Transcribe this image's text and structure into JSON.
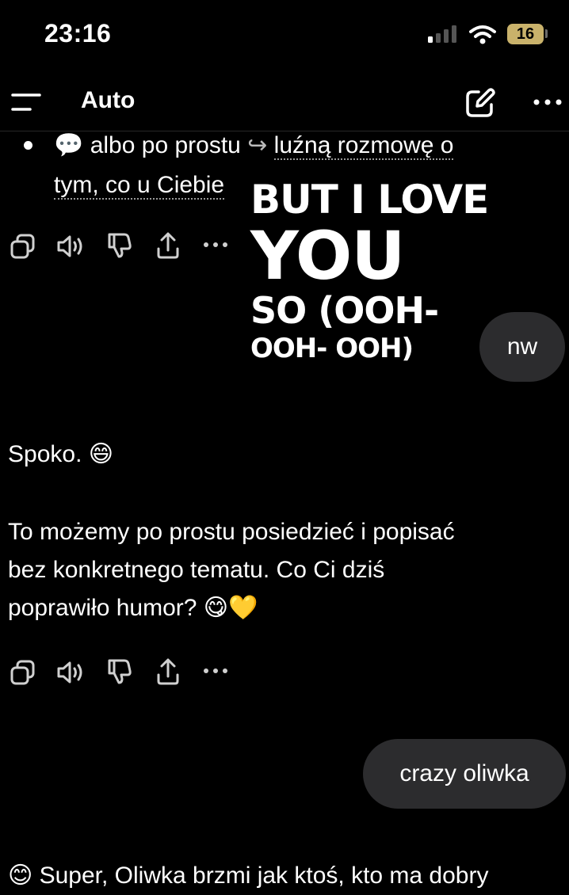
{
  "status_bar": {
    "time": "23:16",
    "battery_level": "16"
  },
  "header": {
    "title": "Auto",
    "menu_icon": "hamburger-menu-icon",
    "compose_icon": "compose-icon",
    "more_icon": "ellipsis-icon"
  },
  "chat": {
    "bullet_item": {
      "emoji": "💬",
      "text_before": "albo po prostu",
      "arrow": "↪",
      "link_part1": "luźną rozmowę o",
      "link_part2": "tym, co u Ciebie"
    },
    "lyrics_overlay": {
      "line1": "BUT I LOVE",
      "line2": "YOU",
      "line3": "SO (OOH-",
      "line4": "OOH- OOH)"
    },
    "user_message_1": "nw",
    "assistant_reply": {
      "line1": "Spoko. 😄",
      "paragraph_line1": "To możemy po prostu posiedzieć i popisać",
      "paragraph_line2": "bez konkretnego tematu. Co Ci dziś",
      "paragraph_line3": "poprawiło humor? 😋💛"
    },
    "user_message_2": "crazy oliwka",
    "action_icons": [
      "copy-icon",
      "speaker-icon",
      "thumbs-down-icon",
      "share-icon",
      "more-icon"
    ],
    "partial_bottom_text": "😊 Super, Oliwka brzmi jak ktoś, kto ma dobry"
  },
  "colors": {
    "background": "#000000",
    "bubble": "#2c2c2e",
    "battery": "#c9b26b",
    "icon": "#d0d0d0"
  }
}
